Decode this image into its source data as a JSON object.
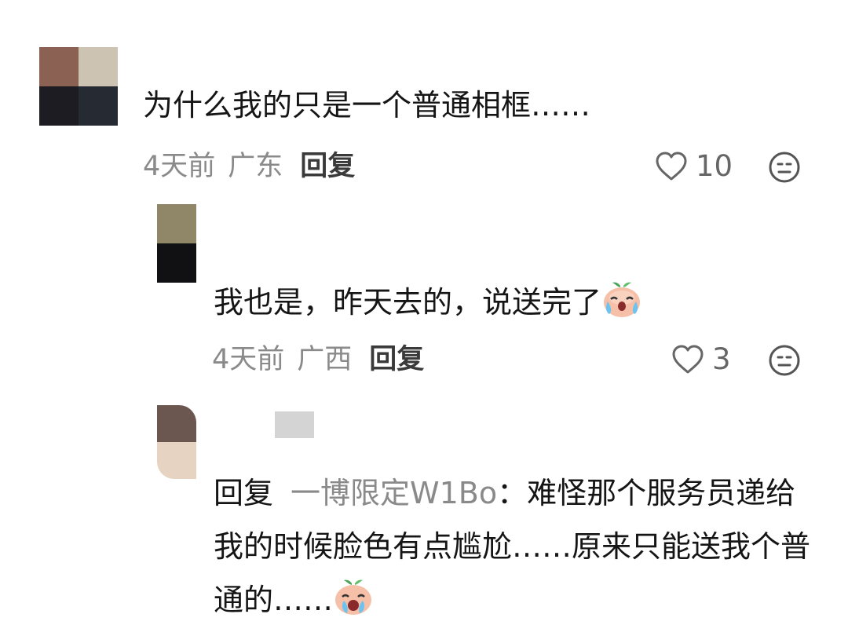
{
  "comments": [
    {
      "text": "为什么我的只是一个普通相框……",
      "time": "4天前",
      "region": "广东",
      "reply_label": "回复",
      "likes": "10",
      "avatar_colors": [
        "#8a6152",
        "#cdc3b3",
        "#1c1c22",
        "#262a33"
      ]
    },
    {
      "text": "我也是，昨天去的，说送完了",
      "time": "4天前",
      "region": "广西",
      "reply_label": "回复",
      "likes": "3",
      "avatar_colors": [
        "#8f8767",
        "#8f8767",
        "#111114",
        "#111114"
      ]
    },
    {
      "reply_prefix": "回复",
      "mention": "一博限定W1Bo",
      "colon": "：",
      "text": "难怪那个服务员递给我的时候脸色有点尴尬……原来只能送我个普通的……",
      "avatar_colors": [
        "#6c5650",
        "#6c5650",
        "#e7d3c1",
        "#e7d3c1"
      ]
    }
  ],
  "icons": {
    "like": "heart-outline-icon",
    "react": "neutral-face-icon",
    "emoji_sticker": "crying-peach-sticker"
  },
  "colors": {
    "meta_gray": "#8a8a8a",
    "reply_dark": "#3a3a3a",
    "text": "#151515"
  }
}
